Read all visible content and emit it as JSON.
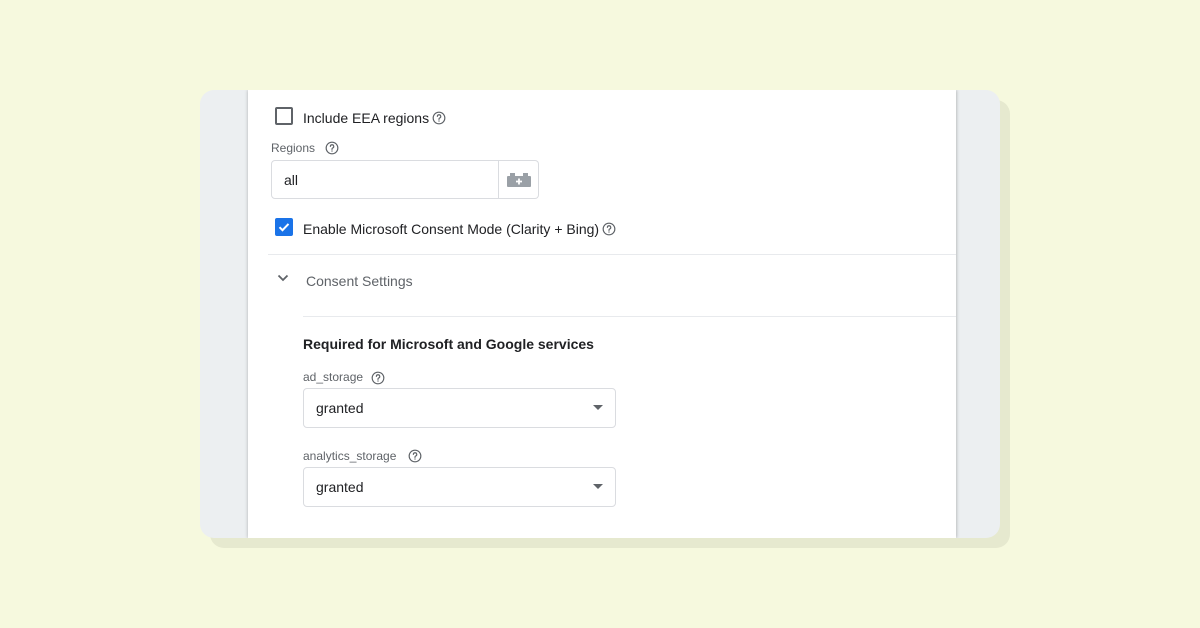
{
  "eea": {
    "label": "Include EEA regions",
    "checked": false,
    "icon": "help-icon"
  },
  "regions": {
    "label": "Regions",
    "value": "all",
    "variable_icon": "variable-picker-icon"
  },
  "microsoft": {
    "label": "Enable Microsoft Consent Mode (Clarity + Bing)",
    "checked": true
  },
  "consent_settings": {
    "label": "Consent Settings",
    "expanded": true
  },
  "required": {
    "title": "Required for Microsoft and Google services",
    "ad_storage": {
      "label": "ad_storage",
      "value": "granted"
    },
    "analytics_storage": {
      "label": "analytics_storage",
      "value": "granted"
    }
  },
  "colors": {
    "page_bg": "#f6f9de",
    "accent": "#1a73e8"
  }
}
